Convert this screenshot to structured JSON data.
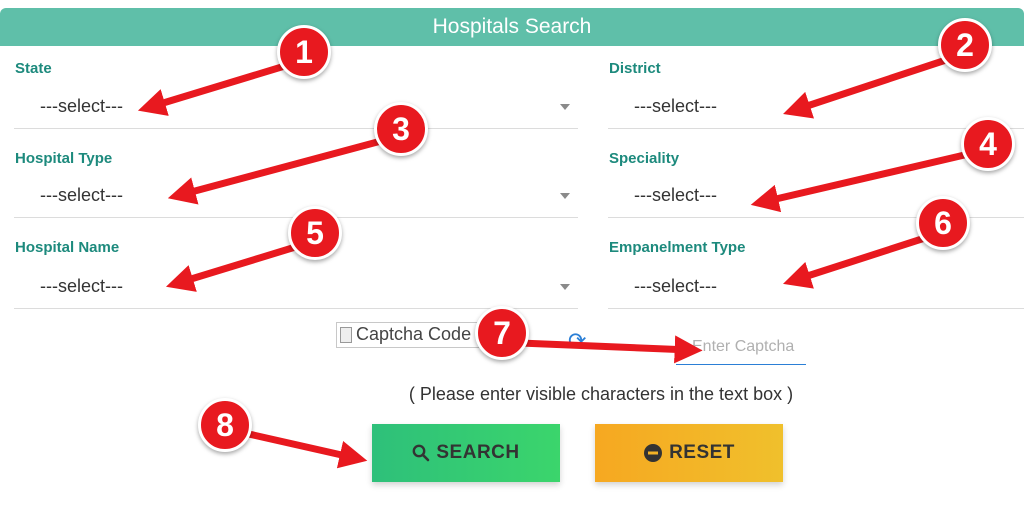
{
  "header": {
    "title": "Hospitals Search"
  },
  "fields": {
    "state": {
      "label": "State",
      "value": "---select---"
    },
    "district": {
      "label": "District",
      "value": "---select---"
    },
    "hospital_type": {
      "label": "Hospital Type",
      "value": "---select---"
    },
    "speciality": {
      "label": "Speciality",
      "value": "---select---"
    },
    "hospital_name": {
      "label": "Hospital Name",
      "value": "---select---"
    },
    "empanelment_type": {
      "label": "Empanelment Type",
      "value": "---select---"
    }
  },
  "captcha": {
    "image_alt": "Captcha Code",
    "input_placeholder": "Enter Captcha",
    "hint": "( Please enter visible characters in the text box )"
  },
  "buttons": {
    "search": "SEARCH",
    "reset": "RESET"
  },
  "annotations": [
    "1",
    "2",
    "3",
    "4",
    "5",
    "6",
    "7",
    "8"
  ],
  "colors": {
    "header": "#5fbfa9",
    "label": "#1d8a7d",
    "search": "#34c873",
    "reset": "#f4b326",
    "annotation": "#e8191f"
  }
}
